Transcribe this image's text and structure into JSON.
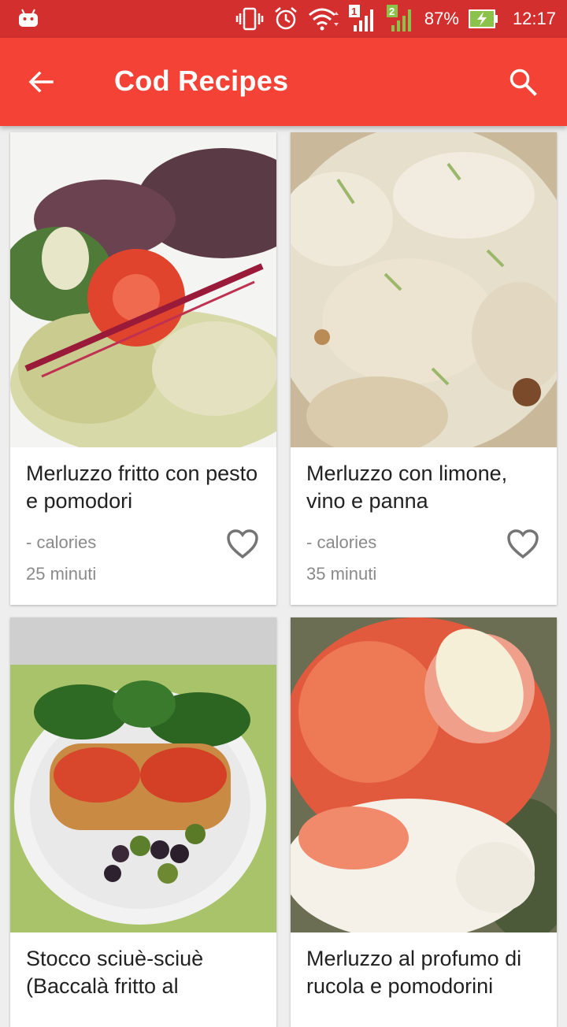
{
  "status_bar": {
    "battery": "87%",
    "time": "12:17",
    "sim1": "1",
    "sim2": "2"
  },
  "app_bar": {
    "title": "Cod Recipes",
    "back_icon": "arrow-back-icon",
    "search_icon": "search-icon"
  },
  "colors": {
    "status_bar": "#d32f2f",
    "app_bar": "#f44336",
    "background": "#eeeeee"
  },
  "recipes": [
    {
      "name": "Merluzzo fritto con pesto e pomodori",
      "calories": "- calories",
      "time": "25 minuti"
    },
    {
      "name": "Merluzzo con limone, vino e panna",
      "calories": "- calories",
      "time": "35 minuti"
    },
    {
      "name": "Stocco sciuè-sciuè (Baccalà fritto al",
      "calories": "",
      "time": ""
    },
    {
      "name": "Merluzzo al profumo di rucola e pomodorini",
      "calories": "",
      "time": ""
    }
  ]
}
